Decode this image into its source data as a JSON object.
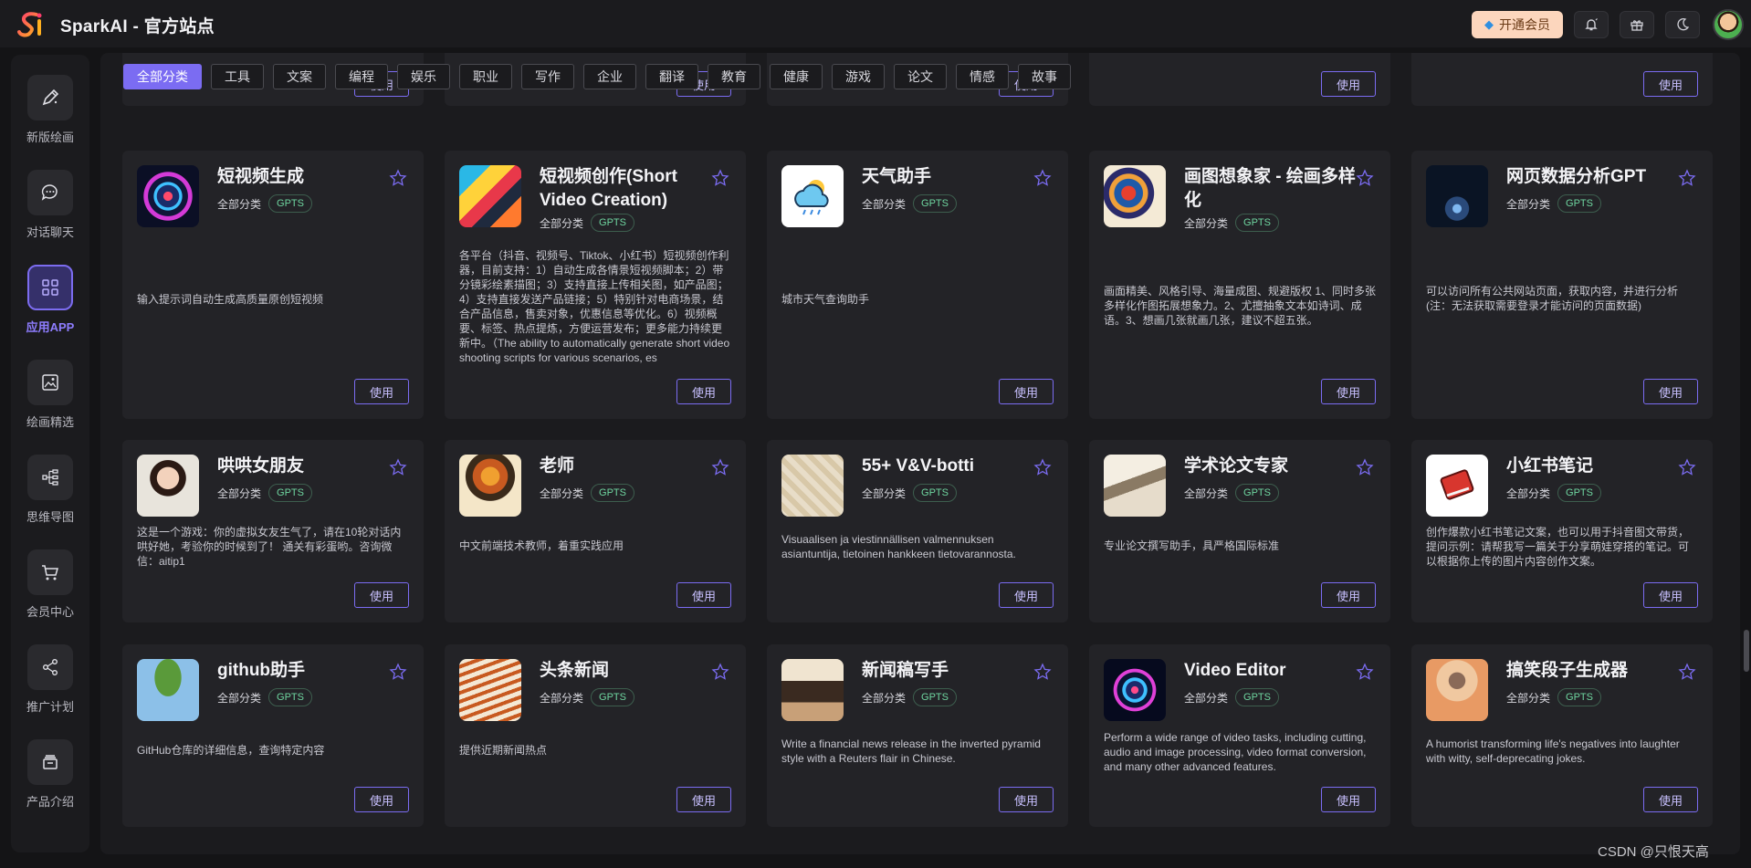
{
  "header": {
    "title": "SparkAI - 官方站点",
    "vip_label": "开通会员",
    "icons": [
      "bell-icon",
      "gift-icon",
      "moon-icon"
    ]
  },
  "sidebar": {
    "items": [
      {
        "label": "新版绘画",
        "icon": "brush-icon"
      },
      {
        "label": "对话聊天",
        "icon": "chat-icon"
      },
      {
        "label": "应用APP",
        "icon": "grid-icon",
        "active": true
      },
      {
        "label": "绘画精选",
        "icon": "image-icon"
      },
      {
        "label": "思维导图",
        "icon": "mindmap-icon"
      },
      {
        "label": "会员中心",
        "icon": "cart-icon"
      },
      {
        "label": "推广计划",
        "icon": "share-icon"
      },
      {
        "label": "产品介绍",
        "icon": "box-icon"
      }
    ]
  },
  "filters": [
    "全部分类",
    "工具",
    "文案",
    "编程",
    "娱乐",
    "职业",
    "写作",
    "企业",
    "翻译",
    "教育",
    "健康",
    "游戏",
    "论文",
    "情感",
    "故事"
  ],
  "use_label": "使用",
  "category_label": "全部分类",
  "tag_label": "GPTS",
  "cards": [
    {
      "title": "短视频生成",
      "desc": "输入提示词自动生成高质量原创短视频"
    },
    {
      "title": "短视频创作(Short Video Creation)",
      "desc": "各平台（抖音、视频号、Tiktok、小红书）短视频创作利器，目前支持：1）自动生成各情景短视频脚本；2）带分镜彩绘素描图；3）支持直接上传相关图，如产品图；4）支持直接发送产品链接；5）特别针对电商场景，结合产品信息，售卖对象，优惠信息等优化。6）视频概要、标签、热点提炼，方便运营发布；更多能力持续更新中。（The ability to automatically generate short video shooting scripts for various scenarios, es"
    },
    {
      "title": "天气助手",
      "desc": "城市天气查询助手"
    },
    {
      "title": "画图想象家 - 绘画多样化",
      "desc": "画面精美、风格引导、海量成图、规避版权 1、同时多张多样化作图拓展想象力。2、尤擅抽象文本如诗词、成语。3、想画几张就画几张，建议不超五张。"
    },
    {
      "title": "网页数据分析GPT",
      "desc": "可以访问所有公共网站页面，获取内容，并进行分析(注：无法获取需要登录才能访问的页面数据)"
    },
    {
      "title": "哄哄女朋友",
      "desc": "这是一个游戏：你的虚拟女友生气了，请在10轮对话内哄好她，考验你的时候到了！ 通关有彩蛋哟。咨询微信：aitip1"
    },
    {
      "title": "老师",
      "desc": "中文前端技术教师，着重实践应用"
    },
    {
      "title": "55+ V&V-botti",
      "desc": "Visuaalisen ja viestinnällisen valmennuksen asiantuntija, tietoinen hankkeen tietovarannosta."
    },
    {
      "title": "学术论文专家",
      "desc": "专业论文撰写助手，具严格国际标准"
    },
    {
      "title": "小红书笔记",
      "desc": "创作爆款小红书笔记文案，也可以用于抖音图文带货，提问示例：请帮我写一篇关于分享萌娃穿搭的笔记。可以根据你上传的图片内容创作文案。"
    },
    {
      "title": "github助手",
      "desc": "GitHub仓库的详细信息，查询特定内容"
    },
    {
      "title": "头条新闻",
      "desc": "提供近期新闻热点"
    },
    {
      "title": "新闻稿写手",
      "desc": "Write a financial news release in the inverted pyramid style with a Reuters flair in Chinese."
    },
    {
      "title": "Video Editor",
      "desc": "Perform a wide range of video tasks, including cutting, audio and image processing, video format conversion, and many other advanced features."
    },
    {
      "title": "搞笑段子生成器",
      "desc": "A humorist transforming life's negatives into laughter with witty, self-deprecating jokes."
    }
  ],
  "watermark": "CSDN @只恨天高",
  "colors": {
    "accent": "#7b6cf2",
    "tag": "#6fd6a0",
    "vip": "#fcd6bd"
  }
}
